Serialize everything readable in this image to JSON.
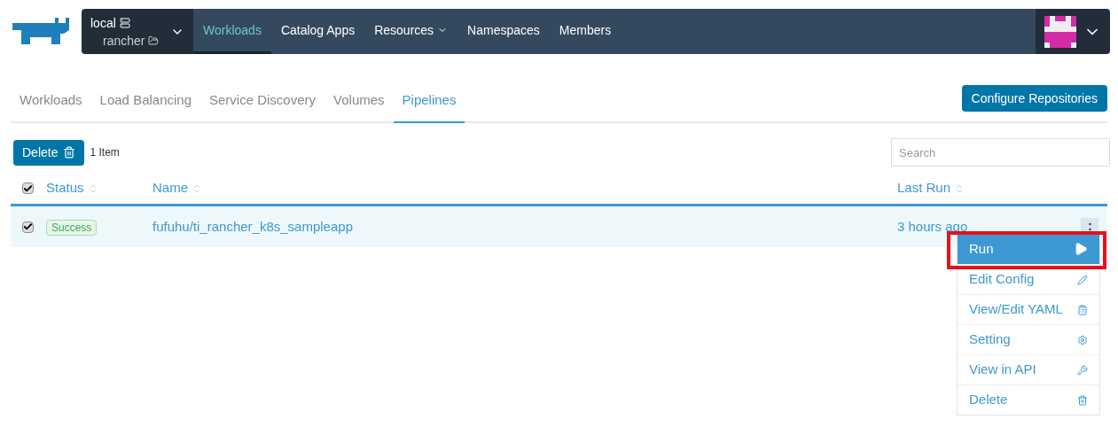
{
  "header": {
    "cluster": "local",
    "project": "rancher",
    "nav": [
      {
        "label": "Workloads",
        "selected": true,
        "dropdown": false
      },
      {
        "label": "Catalog Apps",
        "selected": false,
        "dropdown": false
      },
      {
        "label": "Resources",
        "selected": false,
        "dropdown": true
      },
      {
        "label": "Namespaces",
        "selected": false,
        "dropdown": false
      },
      {
        "label": "Members",
        "selected": false,
        "dropdown": false
      }
    ]
  },
  "tabs": [
    {
      "label": "Workloads",
      "selected": false
    },
    {
      "label": "Load Balancing",
      "selected": false
    },
    {
      "label": "Service Discovery",
      "selected": false
    },
    {
      "label": "Volumes",
      "selected": false
    },
    {
      "label": "Pipelines",
      "selected": true
    }
  ],
  "configure_button": "Configure Repositories",
  "toolbar": {
    "delete_button": "Delete",
    "count": "1 Item",
    "search": {
      "placeholder": "Search"
    }
  },
  "table": {
    "all_checked": true,
    "columns": [
      "Status",
      "Name",
      "Last Run"
    ],
    "rows": [
      {
        "checked": true,
        "status": "Success",
        "name": "fufuhu/ti_rancher_k8s_sampleapp",
        "last_run": "3 hours ago"
      }
    ]
  },
  "menu": [
    {
      "label": "Run",
      "kind": "run",
      "selected": true
    },
    {
      "label": "Edit Config",
      "kind": "edit",
      "selected": false
    },
    {
      "label": "View/Edit YAML",
      "kind": "yaml",
      "selected": false
    },
    {
      "label": "Setting",
      "kind": "setting",
      "selected": false
    },
    {
      "label": "View in API",
      "kind": "api",
      "selected": false
    },
    {
      "label": "Delete",
      "kind": "delete",
      "selected": false
    }
  ]
}
